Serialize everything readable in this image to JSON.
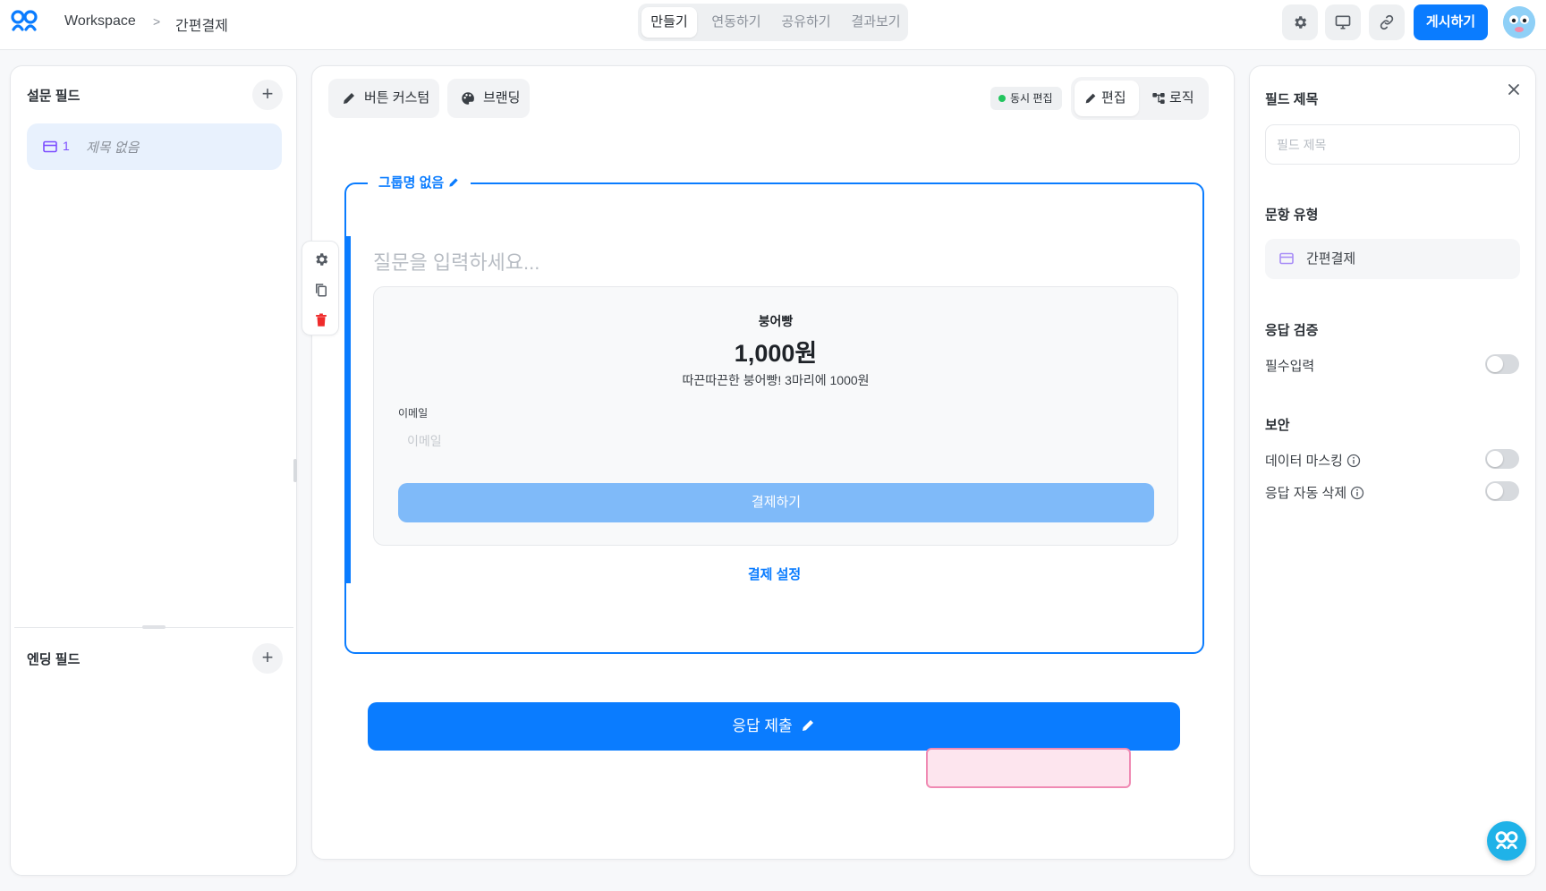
{
  "header": {
    "workspace": "Workspace",
    "separator": ">",
    "current": "간편결제",
    "tabs": [
      {
        "label": "만들기",
        "active": true
      },
      {
        "label": "연동하기",
        "active": false
      },
      {
        "label": "공유하기",
        "active": false
      },
      {
        "label": "결과보기",
        "active": false
      }
    ],
    "publish_label": "게시하기"
  },
  "left_panel": {
    "survey_fields_title": "설문 필드",
    "field_items": [
      {
        "number": "1",
        "label": "제목 없음"
      }
    ],
    "ending_fields_title": "엔딩 필드",
    "add_icon": "+"
  },
  "toolbar": {
    "button_custom_label": "버튼 커스텀",
    "branding_label": "브랜딩",
    "live_edit_label": "동시 편집",
    "modes": [
      {
        "label": "편집",
        "active": true
      },
      {
        "label": "로직",
        "active": false
      }
    ]
  },
  "editor": {
    "group_name": "그룹명 없음",
    "question_placeholder": "질문을 입력하세요...",
    "payment": {
      "product_name": "붕어빵",
      "price": "1,000원",
      "description": "따끈따끈한 붕어빵! 3마리에 1000원",
      "email_label": "이메일",
      "email_placeholder": "이메일",
      "pay_button": "결제하기"
    },
    "payment_settings_link": "결제 설정",
    "submit_label": "응답 제출"
  },
  "right_panel": {
    "field_title_label": "필드 제목",
    "field_title_placeholder": "필드 제목",
    "question_type_label": "문항 유형",
    "question_type_value": "간편결제",
    "validation_label": "응답 검증",
    "required_label": "필수입력",
    "required_on": false,
    "security_label": "보안",
    "masking_label": "데이터 마스킹",
    "masking_on": false,
    "auto_delete_label": "응답 자동 삭제",
    "auto_delete_on": false
  },
  "colors": {
    "accent": "#0a7cff",
    "accent_light": "#7fbaf9",
    "delete": "#ef2b2b",
    "live_dot": "#22c55e",
    "fab": "#1fb2e8",
    "highlight_pink": "#fde5ee"
  },
  "icons": [
    "logo-icon",
    "settings-icon",
    "monitor-icon",
    "link-icon",
    "pencil-icon",
    "palette-icon",
    "logic-icon",
    "copy-icon",
    "trash-icon",
    "card-icon",
    "close-icon",
    "info-icon",
    "chat-icon"
  ]
}
